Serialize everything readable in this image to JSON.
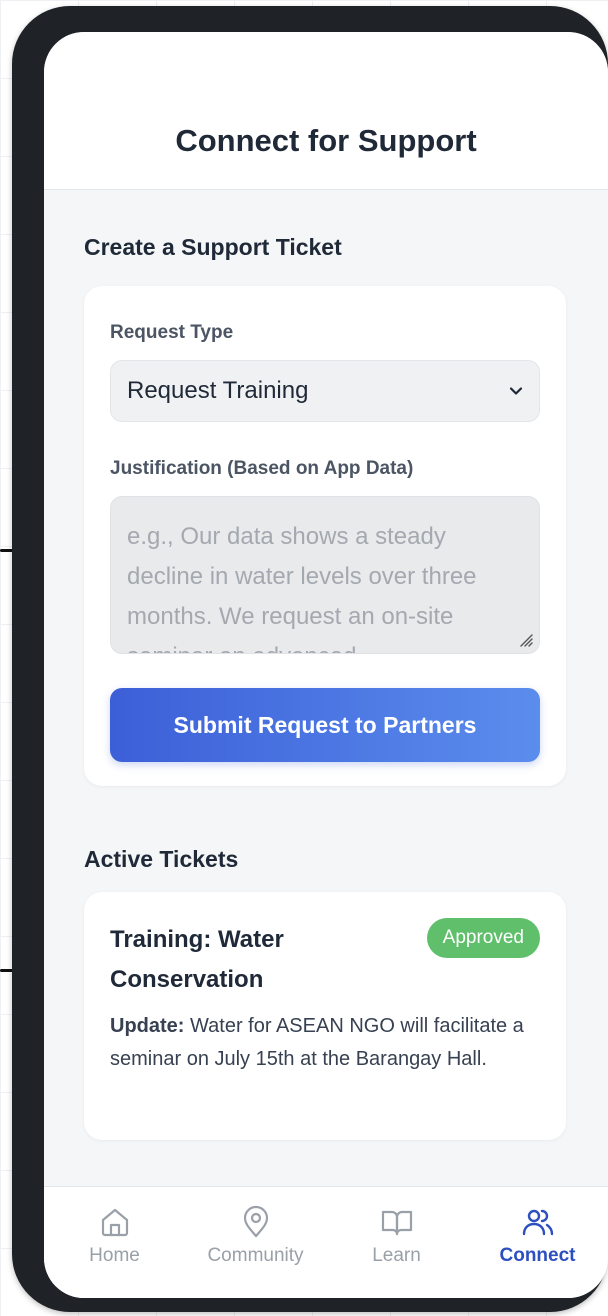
{
  "header": {
    "title": "Connect for Support"
  },
  "create_section": {
    "title": "Create a Support Ticket",
    "request_type_label": "Request Type",
    "request_type_value": "Request Training",
    "justification_label": "Justification (Based on App Data)",
    "justification_placeholder": "e.g., Our data shows a steady decline in water levels over three months. We request an on-site seminar on advanced",
    "submit_label": "Submit Request to Partners"
  },
  "active_section": {
    "title": "Active Tickets",
    "tickets": [
      {
        "title": "Training: Water Conservation",
        "status": "Approved",
        "update_label": "Update:",
        "update_text": " Water for ASEAN NGO will facilitate a seminar on July 15th at the Barangay Hall."
      }
    ]
  },
  "nav": {
    "items": [
      {
        "label": "Home",
        "icon": "home-icon"
      },
      {
        "label": "Community",
        "icon": "map-pin-icon"
      },
      {
        "label": "Learn",
        "icon": "book-icon"
      },
      {
        "label": "Connect",
        "icon": "users-icon",
        "active": true
      }
    ]
  },
  "colors": {
    "accent": "#2d4fbf",
    "button_gradient_start": "#3c5fd8",
    "button_gradient_end": "#5b8ded",
    "approved_badge": "#5fbf6b",
    "phone_frame": "#1f2328"
  }
}
